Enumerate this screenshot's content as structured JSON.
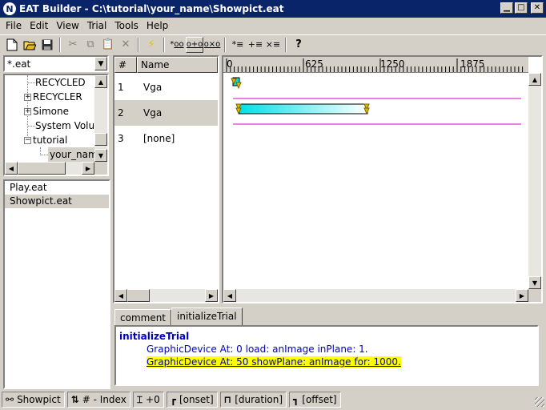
{
  "window": {
    "title": "EAT Builder - C:\\tutorial\\your_name\\Showpict.eat",
    "icon_letter": "N"
  },
  "menu": [
    "File",
    "Edit",
    "View",
    "Trial",
    "Tools",
    "Help"
  ],
  "file_filter": "*.eat",
  "tree": {
    "items": [
      {
        "label": "RECYCLED",
        "expander": ""
      },
      {
        "label": "RECYCLER",
        "expander": "+"
      },
      {
        "label": "Simone",
        "expander": "+"
      },
      {
        "label": "System Volu",
        "expander": ""
      },
      {
        "label": "tutorial",
        "expander": "−"
      },
      {
        "label": "your_nam",
        "expander": ""
      }
    ]
  },
  "files": [
    "Play.eat",
    "Showpict.eat"
  ],
  "trials": {
    "headers": {
      "num": "#",
      "name": "Name"
    },
    "rows": [
      {
        "num": "1",
        "name": "Vga"
      },
      {
        "num": "2",
        "name": "Vga"
      },
      {
        "num": "3",
        "name": "[none]"
      }
    ]
  },
  "timeline": {
    "ticks": [
      "0",
      "625",
      "1250",
      "1875"
    ],
    "events": [
      {
        "trial": 1,
        "start": 0,
        "duration": 30
      },
      {
        "trial": 2,
        "start": 50,
        "duration": 1000
      }
    ],
    "accent": "#00e0e8",
    "divider_color": "#d000d0"
  },
  "tabs": [
    "comment",
    "initializeTrial"
  ],
  "editor": {
    "heading": "initializeTrial",
    "lines": [
      "GraphicDevice At: 0 load: anImage inPlane: 1.",
      "GraphicDevice At: 50 showPlane: anImage for: 1000."
    ]
  },
  "status": {
    "file": "Showpict",
    "index": "# - Index",
    "offset_plus": "+0",
    "onset": "[onset]",
    "duration": "[duration]",
    "offset": "[offset]"
  }
}
